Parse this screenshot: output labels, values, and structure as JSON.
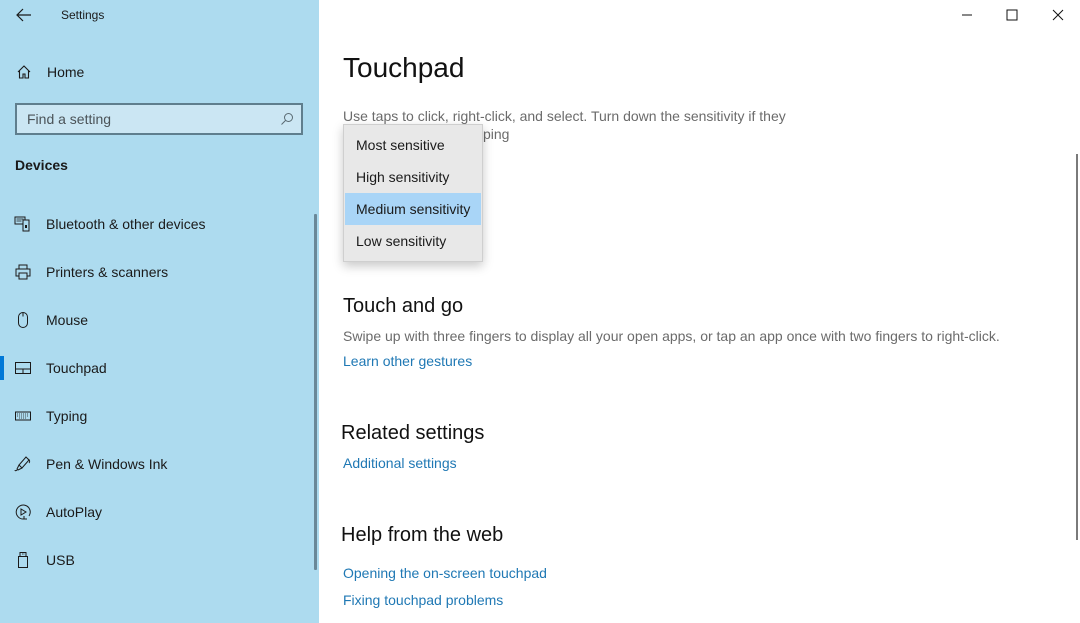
{
  "window": {
    "title": "Settings",
    "controls": {
      "minimize": "minimize-icon",
      "maximize": "maximize-icon",
      "close": "close-icon"
    }
  },
  "sidebar": {
    "back_icon": "back-arrow-icon",
    "home": {
      "label": "Home",
      "icon": "home-icon"
    },
    "search": {
      "placeholder": "Find a setting",
      "value": "",
      "icon": "search-icon"
    },
    "section_title": "Devices",
    "items": [
      {
        "label": "Bluetooth & other devices",
        "icon": "bluetooth-devices-icon",
        "active": false
      },
      {
        "label": "Printers & scanners",
        "icon": "printer-icon",
        "active": false
      },
      {
        "label": "Mouse",
        "icon": "mouse-icon",
        "active": false
      },
      {
        "label": "Touchpad",
        "icon": "touchpad-icon",
        "active": true
      },
      {
        "label": "Typing",
        "icon": "keyboard-icon",
        "active": false
      },
      {
        "label": "Pen & Windows Ink",
        "icon": "pen-icon",
        "active": false
      },
      {
        "label": "AutoPlay",
        "icon": "autoplay-icon",
        "active": false
      },
      {
        "label": "USB",
        "icon": "usb-icon",
        "active": false
      }
    ]
  },
  "main": {
    "title": "Touchpad",
    "taps": {
      "description_line1": "Use taps to click, right-click, and select. Turn down the sensitivity if they",
      "description_line2_visible": "ping",
      "sensitivity_dropdown": {
        "options": [
          "Most sensitive",
          "High sensitivity",
          "Medium sensitivity",
          "Low sensitivity"
        ],
        "selected": "Medium sensitivity"
      }
    },
    "touch_and_go": {
      "heading": "Touch and go",
      "text": "Swipe up with three fingers to display all your open apps, or tap an app once with two fingers to right-click.",
      "link": "Learn other gestures"
    },
    "related_settings": {
      "heading": "Related settings",
      "links": [
        "Additional settings"
      ]
    },
    "help": {
      "heading": "Help from the web",
      "links": [
        "Opening the on-screen touchpad",
        "Fixing touchpad problems"
      ]
    }
  },
  "colors": {
    "sidebar_bg": "#addbef",
    "accent": "#0078d7",
    "link": "#1f78b4",
    "dropdown_selected": "#a9d5f7"
  }
}
